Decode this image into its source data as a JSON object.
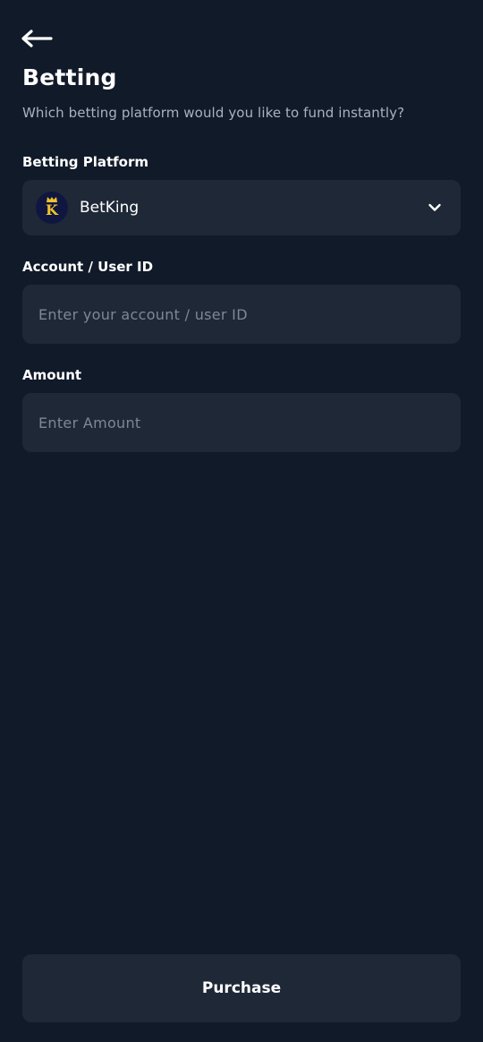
{
  "header": {
    "back_icon": "arrow-left-icon",
    "title": "Betting",
    "subtitle": "Which betting platform would you like to fund instantly?"
  },
  "platform": {
    "label": "Betting Platform",
    "selected": "BetKing",
    "logo_letter": "K",
    "logo_icon": "betking-logo-icon",
    "dropdown_icon": "chevron-down-icon"
  },
  "account": {
    "label": "Account / User ID",
    "value": "",
    "placeholder": "Enter your account / user ID"
  },
  "amount": {
    "label": "Amount",
    "value": "",
    "placeholder": "Enter Amount"
  },
  "actions": {
    "purchase_label": "Purchase"
  },
  "colors": {
    "background": "#111a29",
    "field_background": "#1f2837",
    "subtitle_text": "#aab2bf",
    "placeholder_text": "#7e8796",
    "logo_background": "#0f1740",
    "logo_accent": "#f3c12b"
  }
}
